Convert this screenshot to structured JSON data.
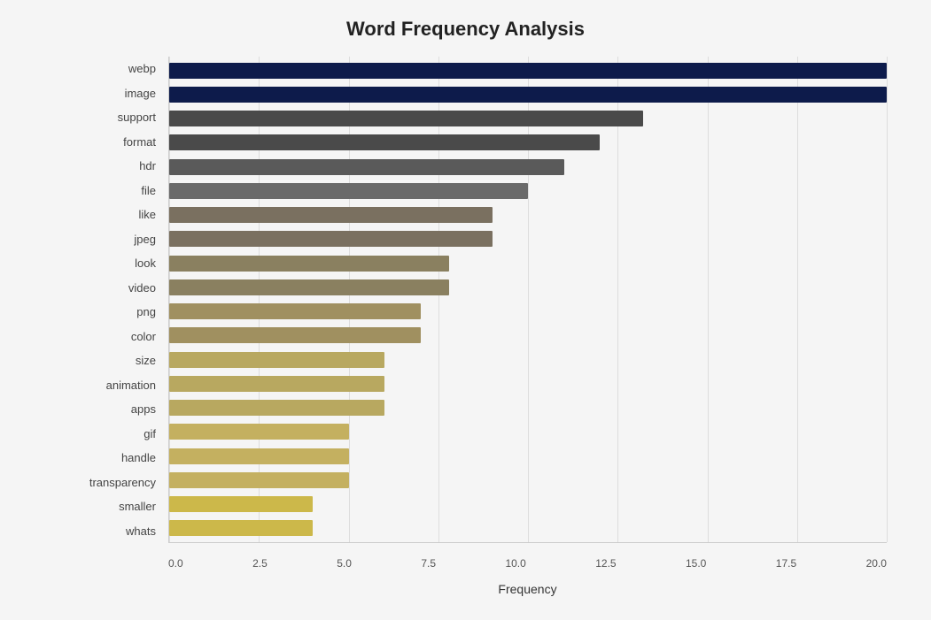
{
  "title": "Word Frequency Analysis",
  "x_axis_label": "Frequency",
  "x_ticks": [
    "0.0",
    "2.5",
    "5.0",
    "7.5",
    "10.0",
    "12.5",
    "15.0",
    "17.5",
    "20.0"
  ],
  "max_value": 20,
  "bars": [
    {
      "label": "webp",
      "value": 20,
      "color": "#0d1b4b"
    },
    {
      "label": "image",
      "value": 20,
      "color": "#0d1b4b"
    },
    {
      "label": "support",
      "value": 13.2,
      "color": "#4a4a4a"
    },
    {
      "label": "format",
      "value": 12.0,
      "color": "#4a4a4a"
    },
    {
      "label": "hdr",
      "value": 11.0,
      "color": "#5a5a5a"
    },
    {
      "label": "file",
      "value": 10.0,
      "color": "#6a6a6a"
    },
    {
      "label": "like",
      "value": 9.0,
      "color": "#7a7060"
    },
    {
      "label": "jpeg",
      "value": 9.0,
      "color": "#7a7060"
    },
    {
      "label": "look",
      "value": 7.8,
      "color": "#8a8060"
    },
    {
      "label": "video",
      "value": 7.8,
      "color": "#8a8060"
    },
    {
      "label": "png",
      "value": 7.0,
      "color": "#a09060"
    },
    {
      "label": "color",
      "value": 7.0,
      "color": "#a09060"
    },
    {
      "label": "size",
      "value": 6.0,
      "color": "#b8a860"
    },
    {
      "label": "animation",
      "value": 6.0,
      "color": "#b8a860"
    },
    {
      "label": "apps",
      "value": 6.0,
      "color": "#b8a860"
    },
    {
      "label": "gif",
      "value": 5.0,
      "color": "#c4b060"
    },
    {
      "label": "handle",
      "value": 5.0,
      "color": "#c4b060"
    },
    {
      "label": "transparency",
      "value": 5.0,
      "color": "#c4b060"
    },
    {
      "label": "smaller",
      "value": 4.0,
      "color": "#ccb84a"
    },
    {
      "label": "whats",
      "value": 4.0,
      "color": "#ccb84a"
    }
  ]
}
